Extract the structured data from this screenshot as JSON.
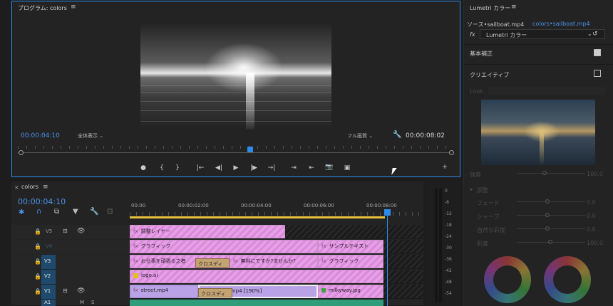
{
  "program": {
    "title": "プログラム: colors",
    "menu": "≡",
    "timecode_current": "00:00:04:10",
    "timecode_total": "00:00:08:02",
    "zoom_select": "全体表示",
    "quality_select": "フル画質",
    "controls": [
      "●",
      "{",
      "}",
      "|←",
      "◀|",
      "▶",
      "|▶",
      "→|",
      "⇥",
      "⇤",
      "📷",
      "▣",
      "+"
    ]
  },
  "timeline": {
    "sequence_name": "colors",
    "menu": "≡",
    "timecode": "00:00:04:10",
    "ruler": [
      "00:00",
      "00:00:02:00",
      "00:00:04:00",
      "00:00:06:00",
      "00:00:08:00"
    ],
    "tracks": [
      {
        "name": "V5",
        "selected": false
      },
      {
        "name": "V4",
        "selected": false
      },
      {
        "name": "V3",
        "selected": true
      },
      {
        "name": "V2",
        "selected": true
      },
      {
        "name": "V1",
        "selected": true
      },
      {
        "name": "A1",
        "selected": true
      }
    ],
    "clips": {
      "v5_adjust": "調整レイヤー",
      "v4_graphic": "グラフィック",
      "v4_sample": "サンプルテキスト",
      "v3_text1": "お仕事を頑張る之者",
      "v3_text2": "無料にですか?ませんか?",
      "v3_graphic": "グラフィック",
      "v2_logo": "logo.ai",
      "v1_street": "street.mp4",
      "v1_sailboat": "sailboat.mp4 [190%]",
      "v1_milkyway": "milkyway.jpg",
      "transition1": "クロスディ",
      "transition2": "クロスディ"
    },
    "toggles": {
      "s": "S",
      "m": "M"
    }
  },
  "meter": {
    "labels": [
      "0",
      "-6",
      "-12",
      "-18",
      "-24",
      "-30",
      "-36",
      "-42",
      "-48",
      "-54"
    ]
  },
  "lumetri": {
    "title": "Lumetri カラー",
    "menu": "≡",
    "source_tab": "ソース•sailboat.mp4",
    "seq_tab": "colors•sailboat.mp4",
    "fx_label": "fx",
    "effect_name": "Lumetri カラー",
    "basic_label": "基本補正",
    "creative_label": "クリエイティブ",
    "look_label": "Look",
    "intensity_label": "強度",
    "intensity_value": "100.0",
    "adjust_label": "調整",
    "faded": {
      "label": "フェード",
      "value": "0.0"
    },
    "sharpen": {
      "label": "シャープ",
      "value": "0.0"
    },
    "vibrance": {
      "label": "自然な彩度",
      "value": "0.0"
    },
    "saturation": {
      "label": "彩度",
      "value": "100.0"
    }
  }
}
